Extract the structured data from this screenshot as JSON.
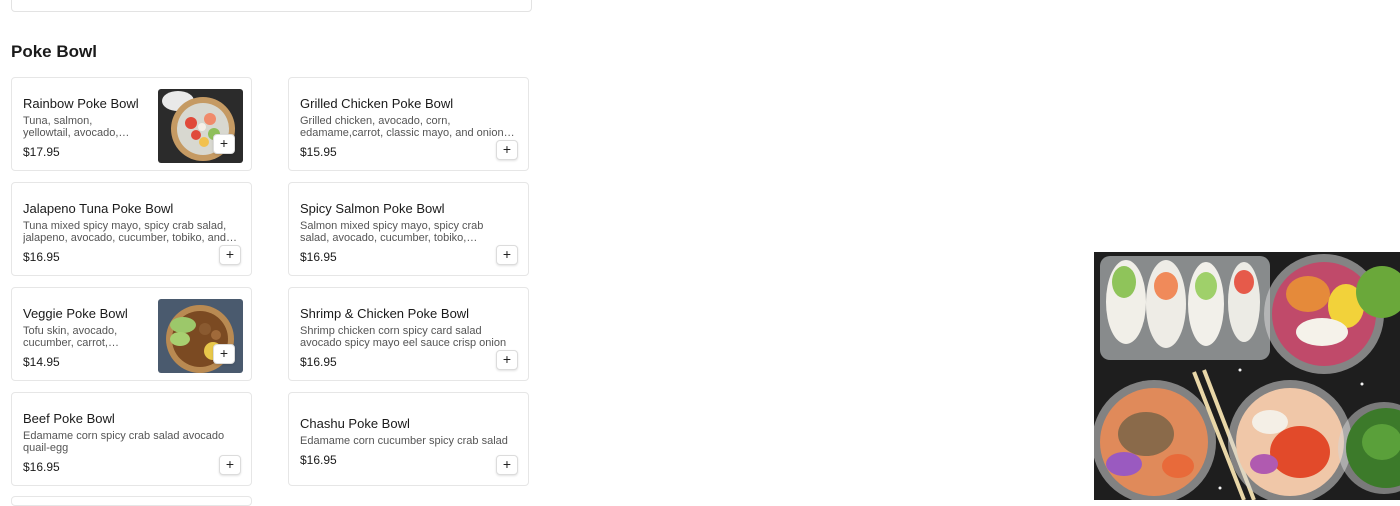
{
  "section": {
    "title": "Poke Bowl"
  },
  "items": [
    {
      "name": "Rainbow Poke Bowl",
      "desc": "Tuna, salmon, yellowtail, avocado, cucumber, edamame, tobiko, and onion",
      "price": "$17.95",
      "add": "+"
    },
    {
      "name": "Grilled Chicken Poke Bowl",
      "desc": "Grilled chicken, avocado, corn, edamame,carrot, classic mayo, and onion crisp",
      "price": "$15.95",
      "add": "+"
    },
    {
      "name": "Jalapeno Tuna Poke Bowl",
      "desc": "Tuna mixed spicy mayo, spicy crab salad, jalapeno, avocado, cucumber, tobiko, and onion crisp",
      "price": "$16.95",
      "add": "+"
    },
    {
      "name": "Spicy Salmon Poke Bowl",
      "desc": "Salmon mixed spicy mayo, spicy crab salad, avocado, cucumber, tobiko, edamame, and onion crisp",
      "price": "$16.95",
      "add": "+"
    },
    {
      "name": "Veggie Poke Bowl",
      "desc": "Tofu skin, avocado, cucumber, carrot, edamame, corn, and seaweed salad",
      "price": "$14.95",
      "add": "+"
    },
    {
      "name": "Shrimp & Chicken Poke Bowl",
      "desc": "Shrimp chicken corn spicy card salad avocado spicy mayo eel sauce crisp onion",
      "price": "$16.95",
      "add": "+"
    },
    {
      "name": "Beef Poke Bowl",
      "desc": "Edamame corn spicy crab salad avocado quail-egg",
      "price": "$16.95",
      "add": "+"
    },
    {
      "name": "Chashu Poke Bowl",
      "desc": "Edamame corn cucumber spicy crab salad",
      "price": "$16.95",
      "add": "+"
    }
  ],
  "icons": {
    "add": "plus-icon"
  }
}
